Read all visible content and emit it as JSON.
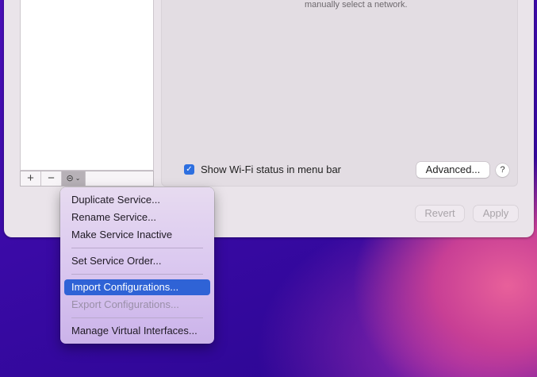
{
  "content": {
    "hint_line": "manually select a network.",
    "hint_extra": "’",
    "show_wifi_label": "Show Wi-Fi status in menu bar",
    "show_wifi_checked": true,
    "check_glyph": "✓",
    "advanced_label": "Advanced...",
    "help_label": "?"
  },
  "footer": {
    "revert_label": "Revert",
    "apply_label": "Apply"
  },
  "sidebar": {
    "toolbar": {
      "add_glyph": "+",
      "remove_glyph": "−",
      "action_glyph": "⊝",
      "chevron_glyph": "⌄"
    }
  },
  "action_menu": {
    "items": [
      {
        "label": "Duplicate Service...",
        "state": "normal"
      },
      {
        "label": "Rename Service...",
        "state": "normal"
      },
      {
        "label": "Make Service Inactive",
        "state": "normal"
      },
      {
        "label": "Set Service Order...",
        "state": "normal"
      },
      {
        "label": "Import Configurations...",
        "state": "highlighted"
      },
      {
        "label": "Export Configurations...",
        "state": "disabled"
      },
      {
        "label": "Manage Virtual Interfaces...",
        "state": "normal"
      }
    ]
  },
  "colors": {
    "accent": "#2f63d6",
    "checkbox": "#2d6fe0"
  }
}
